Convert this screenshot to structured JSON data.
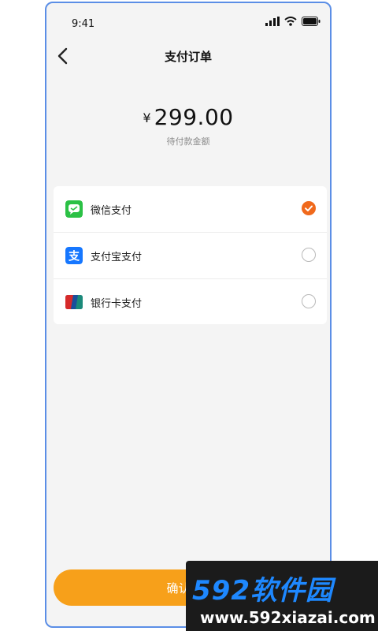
{
  "status_bar": {
    "time": "9:41"
  },
  "nav": {
    "title": "支付订单"
  },
  "amount": {
    "currency": "¥",
    "value": "299.00",
    "caption": "待付款金额"
  },
  "payment_methods": [
    {
      "label": "微信支付",
      "icon": "wechat-pay-icon",
      "selected": true
    },
    {
      "label": "支付宝支付",
      "icon": "alipay-icon",
      "selected": false
    },
    {
      "label": "银行卡支付",
      "icon": "unionpay-icon",
      "selected": false
    }
  ],
  "confirm_button": {
    "label": "确认支付"
  },
  "watermark": {
    "brand": "592软件园",
    "url": "www.592xiazai.com"
  },
  "colors": {
    "accent": "#f0691c",
    "button": "#f7a01a",
    "wechat": "#2bc145",
    "alipay": "#1677ff",
    "unionpay": "#d62a2a"
  }
}
